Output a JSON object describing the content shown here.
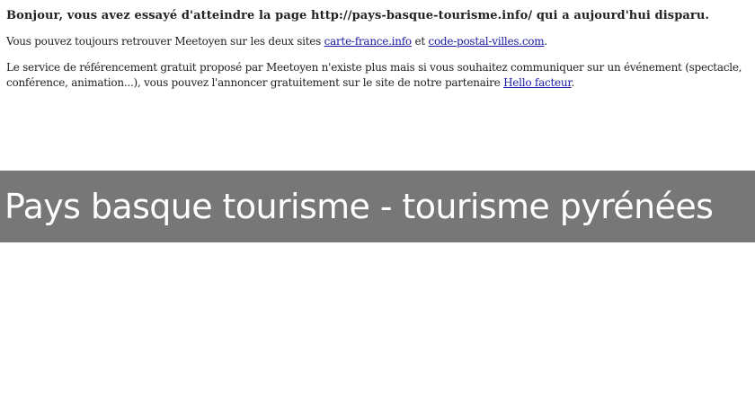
{
  "notice": {
    "heading": "Bonjour, vous avez essayé d'atteindre la page http://pays-basque-tourisme.info/ qui a aujourd'hui disparu.",
    "paragraph1": {
      "before": "Vous pouvez toujours retrouver Meetoyen sur les deux sites ",
      "link1": "carte-france.info",
      "middle": " et ",
      "link2": "code-postal-villes.com",
      "after": "."
    },
    "paragraph2": {
      "before": "Le service de référencement gratuit proposé par Meetoyen n'existe plus mais si vous souhaitez communiquer sur un événement (spectacle, conférence, animation...), vous pouvez l'annoncer gratuitement sur le site de notre partenaire ",
      "link": "Hello facteur",
      "after": "."
    }
  },
  "banner": {
    "title": "Pays basque tourisme - tourisme pyrénées",
    "background_color": "#777777",
    "text_color": "#ffffff"
  },
  "colors": {
    "link": "#1a1aa6",
    "text": "#222222",
    "page_background": "#ffffff"
  }
}
